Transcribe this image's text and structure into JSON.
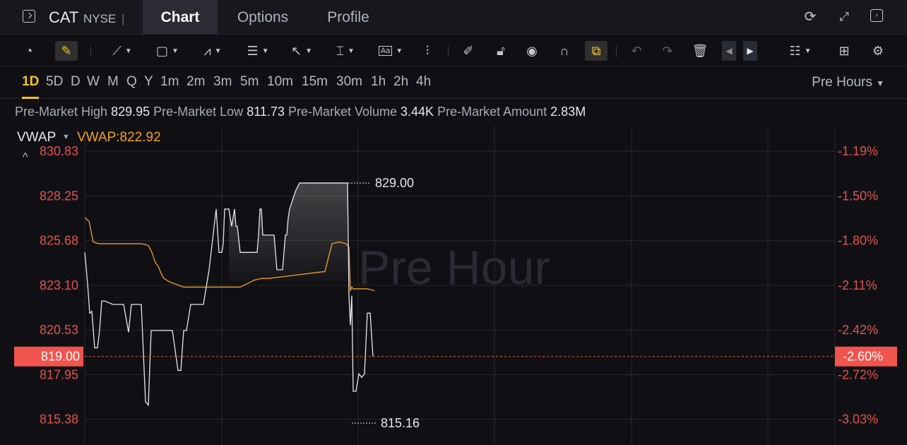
{
  "header": {
    "ticker": "CAT",
    "exchange": "NYSE",
    "separator": "|",
    "tabs": [
      {
        "label": "Chart",
        "active": true
      },
      {
        "label": "Options",
        "active": false
      },
      {
        "label": "Profile",
        "active": false
      }
    ],
    "icons": [
      "refresh-icon",
      "expand-icon",
      "panel-toggle-icon"
    ]
  },
  "toolbar": {
    "tools": [
      "speedometer-icon",
      "pen-highlight-icon",
      "trend-line-icon",
      "rectangle-icon",
      "pattern-icon",
      "fib-icon",
      "arrow-icon",
      "measure-icon",
      "text-icon",
      "candles-icon",
      "edit-icon",
      "lock-icon",
      "eye-icon",
      "magnet-icon",
      "link-icon",
      "undo-icon",
      "redo-icon",
      "delete-icon",
      "prev-icon",
      "next-icon",
      "list-icon",
      "grid-icon",
      "settings-icon"
    ]
  },
  "intervals": {
    "items": [
      "1D",
      "5D",
      "D",
      "W",
      "M",
      "Q",
      "Y",
      "1m",
      "2m",
      "3m",
      "5m",
      "10m",
      "15m",
      "30m",
      "1h",
      "2h",
      "4h"
    ],
    "active": "1D",
    "session_label": "Pre Hours",
    "session_caret": "▼"
  },
  "stats": {
    "high_label": "Pre-Market High",
    "high": "829.95",
    "low_label": "Pre-Market Low",
    "low": "811.73",
    "volume_label": "Pre-Market Volume",
    "volume": "3.44K",
    "amount_label": "Pre-Market Amount",
    "amount": "2.83M"
  },
  "indicator": {
    "name": "VWAP",
    "caret": "▼",
    "value_text": "VWAP:822.92",
    "collapse": "^"
  },
  "colors": {
    "price_line": "#e6e6ea",
    "vwap_line": "#f0a020",
    "down": "#e0524c",
    "accent": "#f5c518"
  },
  "chart_data": {
    "type": "line",
    "watermark": "Pre Hour",
    "ylim": [
      813.9,
      832.3
    ],
    "y_ticks": [
      "830.83",
      "828.25",
      "825.68",
      "823.10",
      "820.53",
      "817.95",
      "815.38"
    ],
    "y_tick_values": [
      830.83,
      828.25,
      825.68,
      823.1,
      820.53,
      817.95,
      815.38
    ],
    "pct_ticks": [
      "-1.19%",
      "-1.50%",
      "-1.80%",
      "-2.11%",
      "-2.42%",
      "-2.72%",
      "-3.03%"
    ],
    "current_price": 819.0,
    "current_price_label": "819.00",
    "current_pct_label": "-2.60%",
    "high_marker": {
      "value": 829.0,
      "label": "829.00",
      "x": 211
    },
    "low_marker": {
      "value": 815.16,
      "label": "815.16",
      "x": 223
    },
    "x_range": [
      0,
      630
    ],
    "series": [
      {
        "kind": "price",
        "x": [
          0,
          4,
          7,
          10,
          14,
          18,
          21,
          24,
          28,
          40,
          55,
          62,
          66,
          68,
          72,
          80,
          86,
          90,
          94,
          98,
          100,
          104,
          114,
          124,
          132,
          136,
          140,
          144,
          150,
          154,
          158,
          162,
          166,
          168,
          176,
          186,
          190,
          194,
          196,
          198,
          204,
          208,
          212,
          214,
          216,
          220,
          224,
          228,
          232,
          236,
          240,
          242,
          244,
          246,
          248,
          250,
          252,
          256,
          260,
          264,
          268,
          272,
          276,
          280,
          284,
          286,
          288,
          290,
          294,
          298,
          304,
          308,
          312,
          316,
          320,
          324,
          328,
          332,
          336,
          340,
          344,
          348,
          352,
          356,
          360,
          364,
          368,
          372,
          374,
          376,
          378,
          380,
          384,
          388,
          392,
          396,
          400,
          404,
          408
        ],
        "values": [
          825.0,
          823.2,
          821.5,
          821.6,
          819.5,
          819.5,
          820.5,
          822.2,
          822.2,
          822.0,
          822.0,
          820.4,
          822.0,
          822.0,
          822.0,
          822.0,
          816.4,
          816.2,
          820.5,
          820.5,
          820.5,
          820.5,
          820.5,
          820.5,
          818.2,
          818.2,
          820.5,
          820.5,
          822.0,
          822.0,
          822.0,
          822.0,
          822.0,
          822.0,
          824.0,
          827.5,
          825.0,
          825.0,
          825.5,
          827.5,
          827.5,
          826.5,
          827.5,
          826.5,
          826.5,
          825.0,
          825.0,
          825.0,
          825.0,
          825.0,
          825.0,
          825.0,
          825.0,
          826.0,
          827.5,
          827.5,
          826.0,
          826.0,
          826.0,
          826.0,
          826.0,
          824.0,
          824.0,
          824.0,
          826.0,
          826.0,
          827.0,
          827.5,
          828.0,
          828.5,
          829.0,
          829.0,
          829.0,
          829.0,
          829.0,
          829.0,
          829.0,
          829.0,
          829.0,
          829.0,
          829.0,
          829.0,
          829.0,
          829.0,
          829.0,
          829.0,
          829.0,
          829.0,
          822.5,
          820.8,
          822.5,
          817.0,
          817.0,
          818.0,
          817.8,
          818.0,
          821.5,
          821.5,
          819.0
        ],
        "name": ""
      },
      {
        "kind": "vwap",
        "x": [
          0,
          6,
          12,
          20,
          40,
          60,
          80,
          90,
          95,
          100,
          104,
          108,
          112,
          120,
          140,
          160,
          180,
          200,
          210,
          220,
          230,
          240,
          250,
          260,
          280,
          300,
          320,
          340,
          350,
          360,
          370,
          374,
          376,
          378,
          380,
          385,
          390,
          400,
          410
        ],
        "values": [
          827.0,
          826.8,
          825.6,
          825.5,
          825.5,
          825.5,
          825.5,
          825.4,
          825.0,
          824.4,
          824.2,
          823.8,
          823.5,
          823.3,
          823.0,
          823.0,
          823.0,
          823.0,
          823.0,
          823.0,
          823.2,
          823.4,
          823.5,
          823.5,
          823.6,
          823.7,
          823.8,
          823.9,
          825.5,
          825.6,
          825.5,
          825.3,
          822.8,
          823.0,
          822.9,
          822.9,
          822.9,
          822.9,
          822.8
        ],
        "name": ""
      }
    ]
  }
}
